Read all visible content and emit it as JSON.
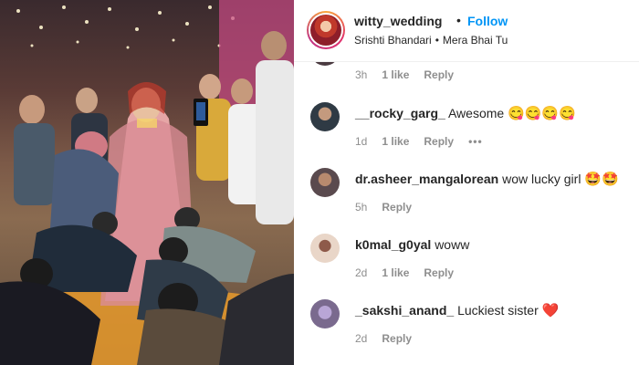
{
  "header": {
    "username": "witty_wedding",
    "dot": "•",
    "follow_label": "Follow",
    "audio_artist": "Srishti Bhandari",
    "audio_sep": "•",
    "audio_title": "Mera Bhai Tu"
  },
  "top_meta": {
    "time": "3h",
    "likes": "1 like",
    "reply": "Reply"
  },
  "comments": [
    {
      "user": "__rocky_garg_",
      "text": "Awesome",
      "emoji": "😋😋😋😋",
      "time": "1d",
      "likes": "1 like",
      "reply": "Reply",
      "more": "•••",
      "avatar_color": "#2f3a44"
    },
    {
      "user": "dr.asheer_mangalorean",
      "text": "wow lucky girl",
      "emoji": "🤩🤩",
      "time": "5h",
      "likes": "",
      "reply": "Reply",
      "more": "",
      "avatar_color": "#5a4a4e"
    },
    {
      "user": "k0mal_g0yal",
      "text": "woww",
      "emoji": "",
      "time": "2d",
      "likes": "1 like",
      "reply": "Reply",
      "more": "",
      "avatar_color": "#e9d6c8"
    },
    {
      "user": "_sakshi_anand_",
      "text": "Luckiest sister",
      "emoji": "❤️",
      "time": "2d",
      "likes": "",
      "reply": "Reply",
      "more": "",
      "avatar_color": "#7a6a8e"
    }
  ]
}
